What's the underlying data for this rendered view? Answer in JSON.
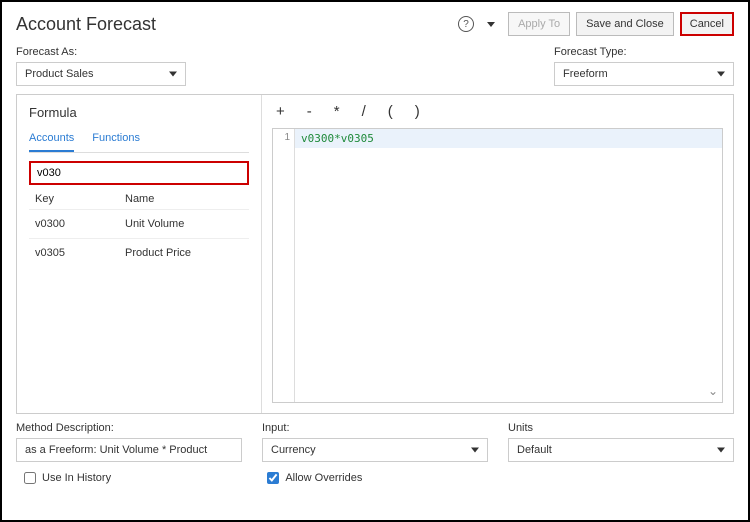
{
  "header": {
    "title": "Account Forecast",
    "apply_to": "Apply To",
    "save_close": "Save and Close",
    "cancel": "Cancel"
  },
  "forecast_as": {
    "label": "Forecast As:",
    "value": "Product Sales"
  },
  "forecast_type": {
    "label": "Forecast Type:",
    "value": "Freeform"
  },
  "formula": {
    "title": "Formula",
    "tabs": {
      "accounts": "Accounts",
      "functions": "Functions"
    },
    "filter_value": "v030",
    "columns": {
      "key": "Key",
      "name": "Name"
    },
    "rows": [
      {
        "key": "v0300",
        "name": "Unit Volume"
      },
      {
        "key": "v0305",
        "name": "Product Price"
      }
    ],
    "operators": {
      "plus": "+",
      "minus": "-",
      "mult": "*",
      "div": "/",
      "lparen": "(",
      "rparen": ")"
    },
    "line_no": "1",
    "expression": "v0300*v0305"
  },
  "method": {
    "label": "Method Description:",
    "value": "as a Freeform:  Unit Volume * Product"
  },
  "input": {
    "label": "Input:",
    "value": "Currency"
  },
  "units": {
    "label": "Units",
    "value": "Default"
  },
  "checks": {
    "use_in_history": "Use In History",
    "allow_overrides": "Allow Overrides"
  },
  "glyphs": {
    "help": "?"
  }
}
